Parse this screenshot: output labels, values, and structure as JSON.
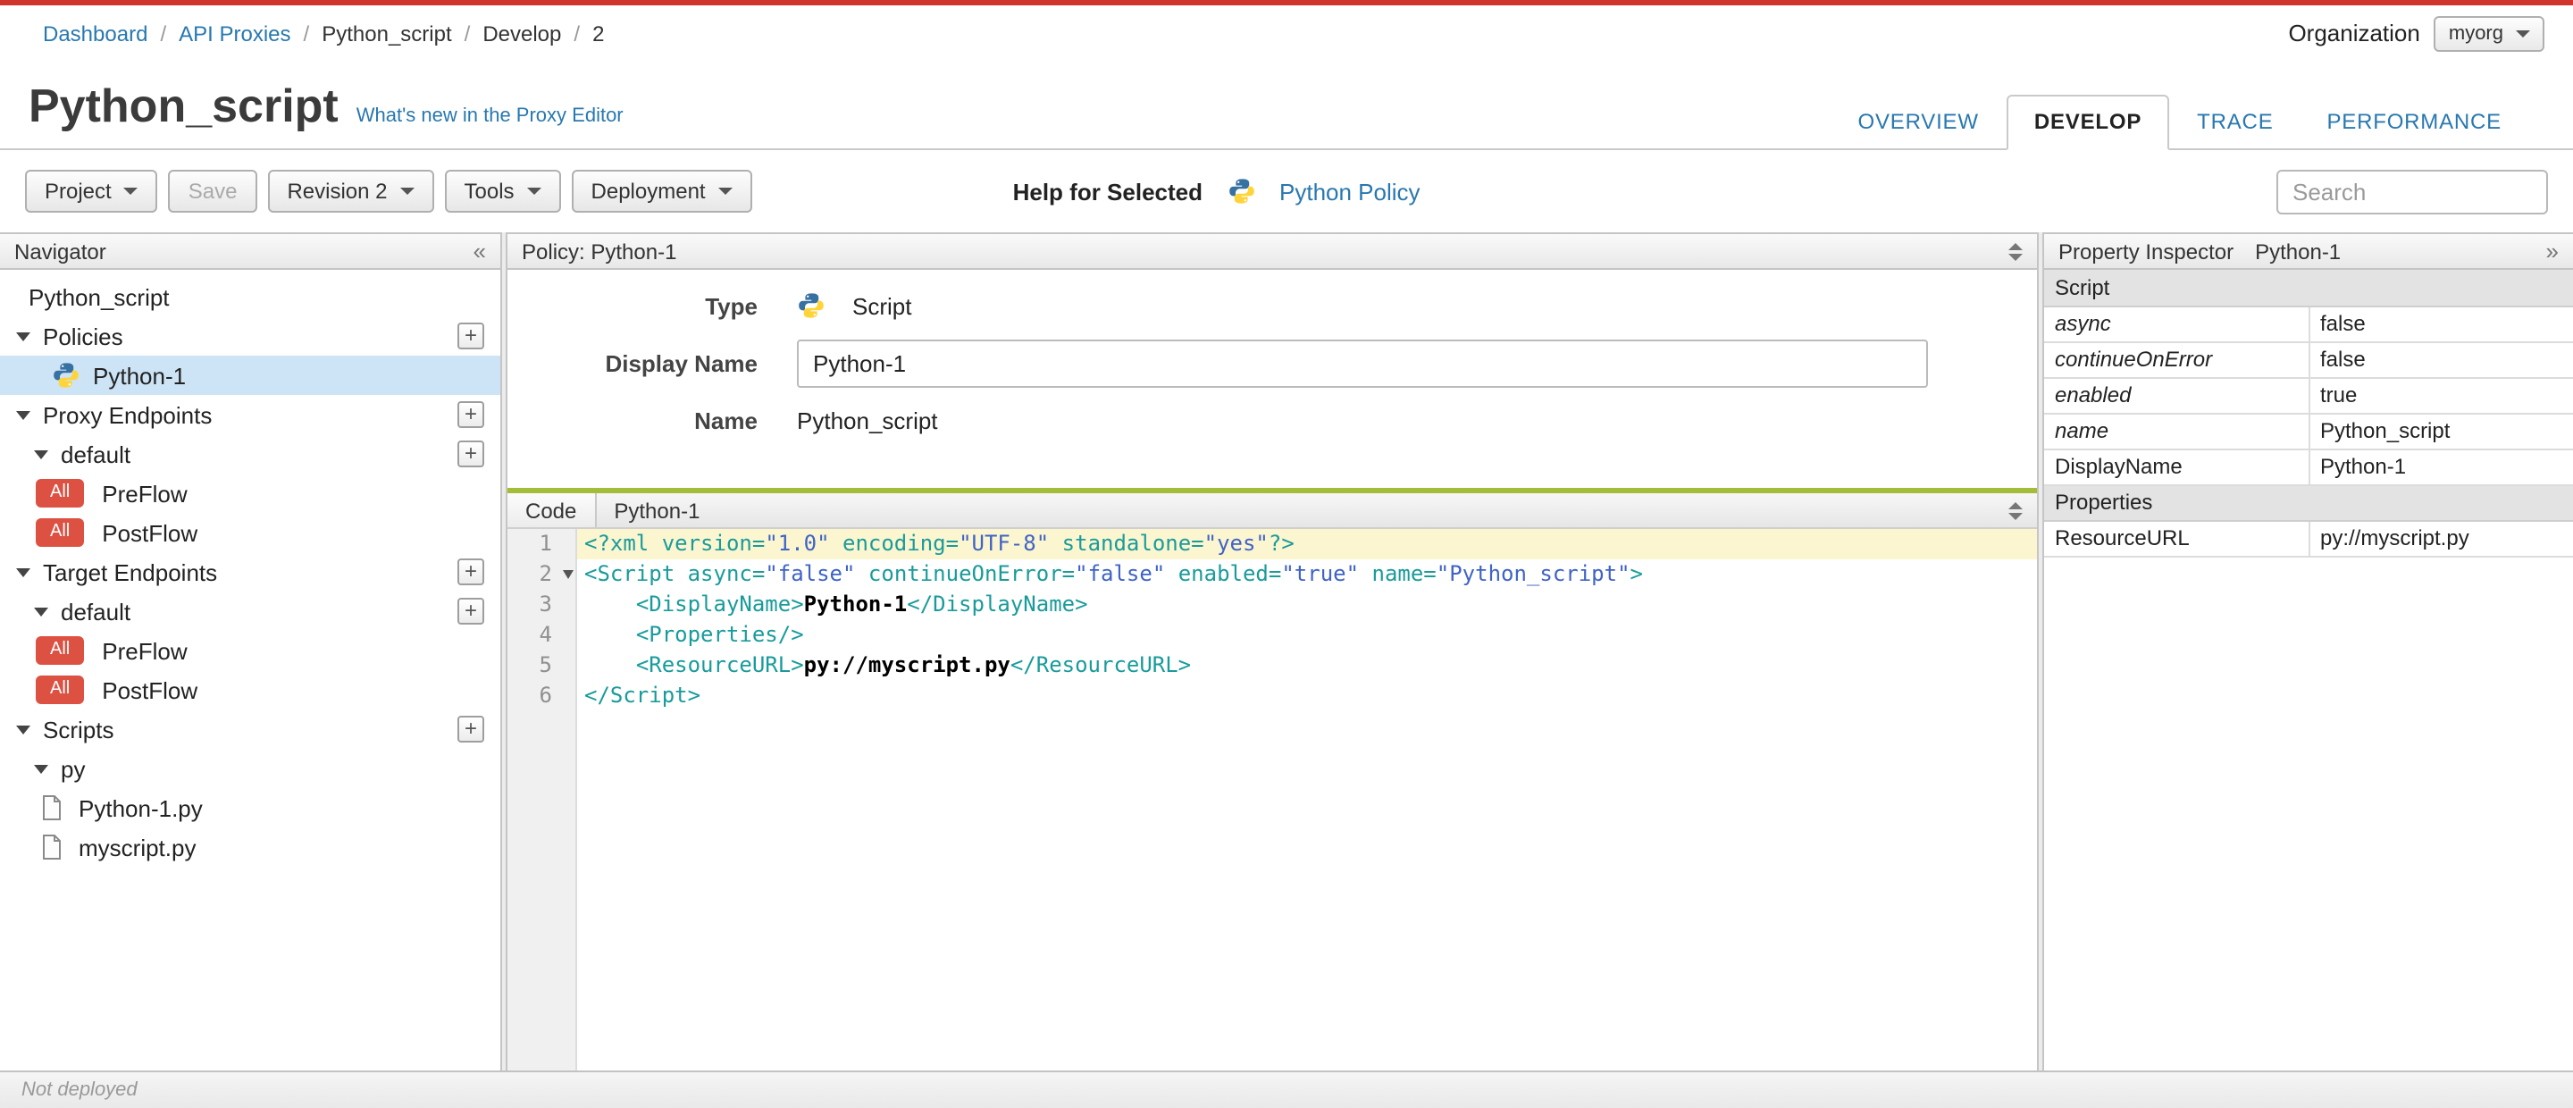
{
  "colors": {
    "accent_red": "#d0342c",
    "link_blue": "#2878b0",
    "badge_red": "#dd5143",
    "selected_row_blue": "#cde4f6",
    "code_tag_teal": "#1a9b9b",
    "code_string_blue": "#3f63c6",
    "splitter_green": "#a3bd3a"
  },
  "topbar": {
    "breadcrumb": [
      {
        "label": "Dashboard",
        "link": true
      },
      {
        "label": "API Proxies",
        "link": true
      },
      {
        "label": "Python_script",
        "link": false
      },
      {
        "label": "Develop",
        "link": false
      },
      {
        "label": "2",
        "link": false
      }
    ],
    "org_label": "Organization",
    "org_value": "myorg"
  },
  "header": {
    "title": "Python_script",
    "whats_new_label": "What's new in the Proxy Editor",
    "tabs": [
      {
        "label": "OVERVIEW",
        "active": false
      },
      {
        "label": "DEVELOP",
        "active": true
      },
      {
        "label": "TRACE",
        "active": false
      },
      {
        "label": "PERFORMANCE",
        "active": false
      }
    ]
  },
  "toolbar": {
    "project_label": "Project",
    "save_label": "Save",
    "revision_label": "Revision 2",
    "tools_label": "Tools",
    "deployment_label": "Deployment",
    "help_label": "Help for Selected",
    "policy_link_label": "Python Policy",
    "search_placeholder": "Search"
  },
  "navigator": {
    "title": "Navigator",
    "items": [
      {
        "kind": "root",
        "label": "Python_script"
      },
      {
        "kind": "section",
        "label": "Policies",
        "arrow": true,
        "plus": true
      },
      {
        "kind": "policy",
        "label": "Python-1",
        "icon": "python",
        "selected": true
      },
      {
        "kind": "section",
        "label": "Proxy Endpoints",
        "arrow": true,
        "plus": true
      },
      {
        "kind": "node",
        "label": "default",
        "arrow": true,
        "plus": true
      },
      {
        "kind": "flow",
        "label": "PreFlow",
        "badge": "All"
      },
      {
        "kind": "flow",
        "label": "PostFlow",
        "badge": "All"
      },
      {
        "kind": "section",
        "label": "Target Endpoints",
        "arrow": true,
        "plus": true
      },
      {
        "kind": "node",
        "label": "default",
        "arrow": true,
        "plus": true
      },
      {
        "kind": "flow",
        "label": "PreFlow",
        "badge": "All"
      },
      {
        "kind": "flow",
        "label": "PostFlow",
        "badge": "All"
      },
      {
        "kind": "section",
        "label": "Scripts",
        "arrow": true,
        "plus": true
      },
      {
        "kind": "node",
        "label": "py",
        "arrow": true
      },
      {
        "kind": "file",
        "label": "Python-1.py",
        "icon": "file"
      },
      {
        "kind": "file",
        "label": "myscript.py",
        "icon": "file"
      }
    ]
  },
  "policy_panel": {
    "header": "Policy: Python-1",
    "type_label": "Type",
    "type_value": "Script",
    "display_name_label": "Display Name",
    "display_name_value": "Python-1",
    "name_label": "Name",
    "name_value": "Python_script"
  },
  "code_panel": {
    "tab_label": "Code",
    "file_label": "Python-1",
    "lines": [
      {
        "highlight": true,
        "tokens": [
          {
            "c": "tag",
            "v": "<?xml version="
          },
          {
            "c": "str",
            "v": "\"1.0\""
          },
          {
            "c": "tag",
            "v": " encoding="
          },
          {
            "c": "str",
            "v": "\"UTF-8\""
          },
          {
            "c": "tag",
            "v": " standalone="
          },
          {
            "c": "str",
            "v": "\"yes\""
          },
          {
            "c": "tag",
            "v": "?>"
          }
        ]
      },
      {
        "fold": true,
        "tokens": [
          {
            "c": "tag",
            "v": "<Script async="
          },
          {
            "c": "str",
            "v": "\"false\""
          },
          {
            "c": "tag",
            "v": " continueOnError="
          },
          {
            "c": "str",
            "v": "\"false\""
          },
          {
            "c": "tag",
            "v": " enabled="
          },
          {
            "c": "str",
            "v": "\"true\""
          },
          {
            "c": "tag",
            "v": " name="
          },
          {
            "c": "str",
            "v": "\"Python_script\""
          },
          {
            "c": "tag",
            "v": ">"
          }
        ]
      },
      {
        "tokens": [
          {
            "c": "plain",
            "v": "    "
          },
          {
            "c": "tag",
            "v": "<DisplayName>"
          },
          {
            "c": "text",
            "v": "Python-1"
          },
          {
            "c": "tag",
            "v": "</DisplayName>"
          }
        ]
      },
      {
        "tokens": [
          {
            "c": "plain",
            "v": "    "
          },
          {
            "c": "tag",
            "v": "<Properties/>"
          }
        ]
      },
      {
        "tokens": [
          {
            "c": "plain",
            "v": "    "
          },
          {
            "c": "tag",
            "v": "<ResourceURL>"
          },
          {
            "c": "text",
            "v": "py://myscript.py"
          },
          {
            "c": "tag",
            "v": "</ResourceURL>"
          }
        ]
      },
      {
        "tokens": [
          {
            "c": "tag",
            "v": "</Script>"
          }
        ]
      }
    ]
  },
  "inspector": {
    "title": "Property Inspector",
    "subtitle": "Python-1",
    "rows": [
      {
        "kind": "section",
        "key": "Script",
        "value": ""
      },
      {
        "kind": "attr",
        "key": "async",
        "value": "false"
      },
      {
        "kind": "attr",
        "key": "continueOnError",
        "value": "false"
      },
      {
        "kind": "attr",
        "key": "enabled",
        "value": "true"
      },
      {
        "kind": "attr",
        "key": "name",
        "value": "Python_script"
      },
      {
        "kind": "elem",
        "key": "DisplayName",
        "value": "Python-1"
      },
      {
        "kind": "section",
        "key": "Properties",
        "value": ""
      },
      {
        "kind": "elem",
        "key": "ResourceURL",
        "value": "py://myscript.py"
      }
    ]
  },
  "statusbar": {
    "text": "Not deployed"
  }
}
